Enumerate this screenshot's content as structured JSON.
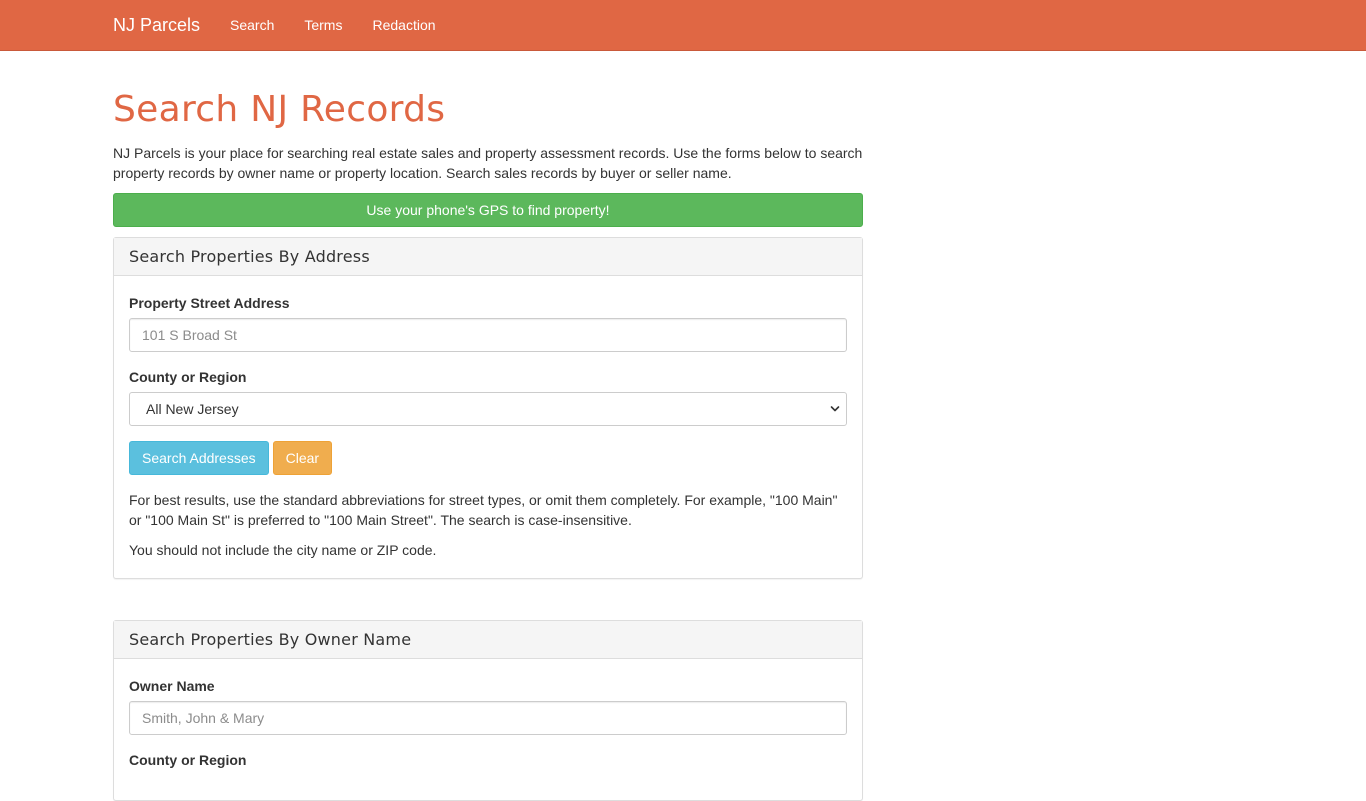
{
  "navbar": {
    "brand": "NJ Parcels",
    "links": [
      "Search",
      "Terms",
      "Redaction"
    ],
    "color": "#e06744"
  },
  "main": {
    "title": "Search NJ Records",
    "intro": "NJ Parcels is your place for searching real estate sales and property assessment records. Use the forms below to search property records by owner name or property location. Search sales records by buyer or seller name.",
    "gps_button": "Use your phone's GPS to find property!"
  },
  "address_panel": {
    "heading": "Search Properties By Address",
    "street_label": "Property Street Address",
    "street_placeholder": "101 S Broad St",
    "county_label": "County or Region",
    "county_selected": "All New Jersey",
    "search_button": "Search Addresses",
    "clear_button": "Clear",
    "help_1": "For best results, use the standard abbreviations for street types, or omit them completely. For example, \"100 Main\" or \"100 Main St\" is preferred to \"100 Main Street\". The search is case-insensitive.",
    "help_2": "You should not include the city name or ZIP code."
  },
  "owner_panel": {
    "heading": "Search Properties By Owner Name",
    "owner_label": "Owner Name",
    "owner_placeholder": "Smith, John & Mary",
    "county_label": "County or Region"
  },
  "icons": {
    "select_arrow": "chevron-down-icon"
  },
  "colors": {
    "gps_green": "#5cb85c",
    "info_blue": "#5bc0de",
    "warning_orange": "#f0ad4e"
  }
}
